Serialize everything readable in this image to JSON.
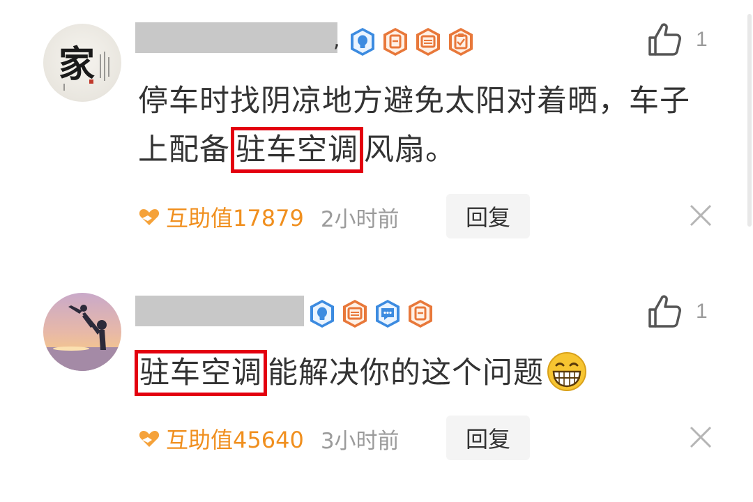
{
  "colors": {
    "accent_orange": "#f08f1e",
    "highlight_red": "#e3000f",
    "text": "#333333",
    "muted": "#9b9b9b"
  },
  "comments": [
    {
      "avatar": "calligraphy-avatar",
      "avatar_char": "家",
      "name_separator": ",",
      "badges": [
        "blue-lightbulb-badge",
        "orange-card-badge",
        "orange-card-badge",
        "orange-checklist-badge"
      ],
      "likes": "1",
      "text_before": "停车时找阴凉地方避免太阳对着晒，车子上配备",
      "highlight": "驻车空调",
      "text_after": "风扇。",
      "help_value": "互助值17879",
      "time": "2小时前",
      "reply_label": "回复"
    },
    {
      "avatar": "sunset-couple-avatar",
      "name_separator": "",
      "badges": [
        "blue-lightbulb-badge",
        "orange-card-badge",
        "blue-chat-badge",
        "orange-card-badge"
      ],
      "likes": "1",
      "text_before": "",
      "highlight": "驻车空调",
      "text_after": "能解决你的这个问题",
      "emoji": "grinning-emoji",
      "help_value": "互助值45640",
      "time": "3小时前",
      "reply_label": "回复"
    }
  ]
}
